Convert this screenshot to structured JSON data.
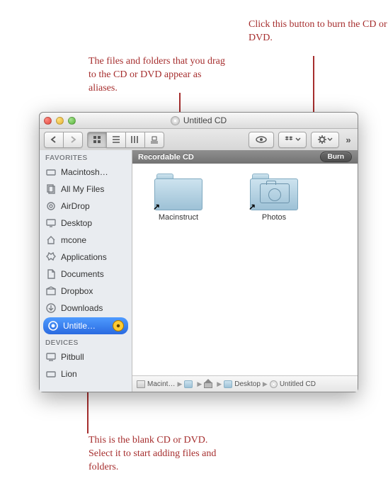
{
  "annotations": {
    "top_right": "Click this button to burn the CD or DVD.",
    "top_left": "The files and folders that you drag to the CD or DVD appear as aliases.",
    "bottom": "This is the blank CD or DVD. Select it to start adding files and folders."
  },
  "window": {
    "title": "Untitled CD"
  },
  "sidebar": {
    "favorites_header": "FAVORITES",
    "devices_header": "DEVICES",
    "favorites": [
      {
        "label": "Macintosh…"
      },
      {
        "label": "All My Files"
      },
      {
        "label": "AirDrop"
      },
      {
        "label": "Desktop"
      },
      {
        "label": "mcone"
      },
      {
        "label": "Applications"
      },
      {
        "label": "Documents"
      },
      {
        "label": "Dropbox"
      },
      {
        "label": "Downloads"
      },
      {
        "label": "Untitle…"
      }
    ],
    "devices": [
      {
        "label": "Pitbull"
      },
      {
        "label": "Lion"
      }
    ]
  },
  "content": {
    "header": "Recordable CD",
    "burn_label": "Burn",
    "items": [
      {
        "label": "Macinstruct"
      },
      {
        "label": "Photos"
      }
    ]
  },
  "pathbar": {
    "items": [
      {
        "label": "Macint…"
      },
      {
        "label": ""
      },
      {
        "label": ""
      },
      {
        "label": "Desktop"
      },
      {
        "label": "Untitled CD"
      }
    ]
  }
}
